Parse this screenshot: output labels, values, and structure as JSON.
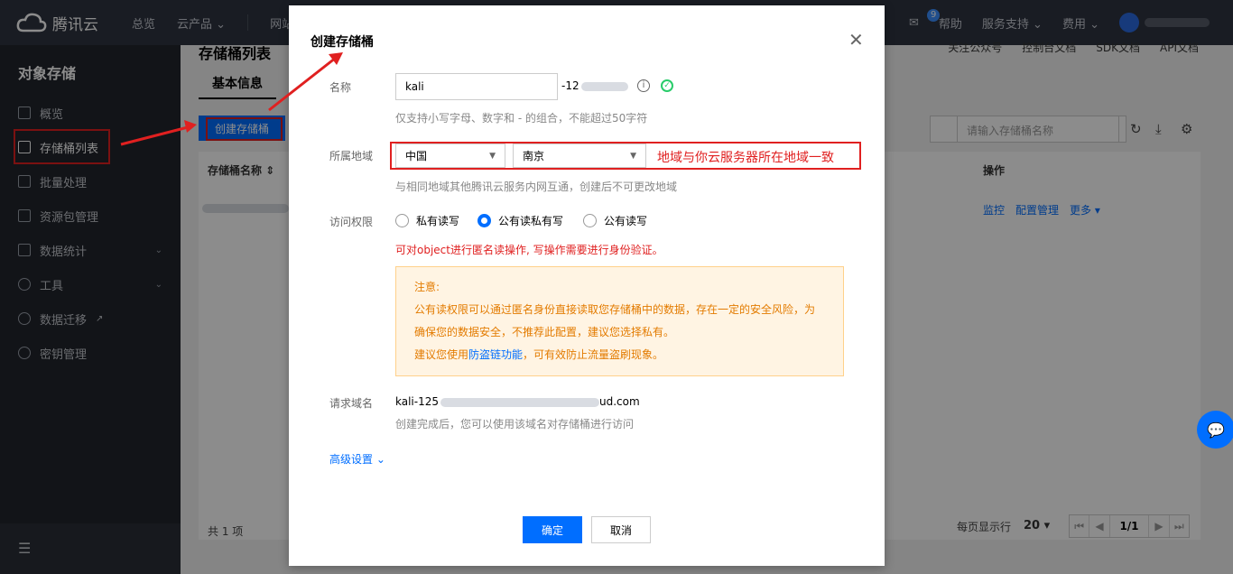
{
  "brand": {
    "name": "腾讯云"
  },
  "topnav": {
    "items": [
      "总览",
      "云产品",
      "网站备"
    ],
    "right": {
      "mail_badge": "9",
      "help": "帮助",
      "support": "服务支持",
      "fees": "费用"
    }
  },
  "sidebar": {
    "title": "对象存储",
    "items": [
      {
        "label": "概览"
      },
      {
        "label": "存储桶列表"
      },
      {
        "label": "批量处理"
      },
      {
        "label": "资源包管理"
      },
      {
        "label": "数据统计"
      },
      {
        "label": "工具"
      },
      {
        "label": "数据迁移"
      },
      {
        "label": "密钥管理"
      }
    ]
  },
  "main": {
    "title": "存储桶列表",
    "tab": "基本信息",
    "links": [
      "关注公众号",
      "控制台文档",
      "SDK文档",
      "API文档"
    ],
    "create_button": "创建存储桶",
    "search_placeholder": "请输入存储桶名称",
    "columns": {
      "name": "存储桶名称",
      "ops": "操作"
    },
    "row_actions": [
      "监控",
      "配置管理",
      "更多"
    ],
    "total": "共 1 项",
    "page_size_label": "每页显示行",
    "page_size": "20",
    "page": "1/1"
  },
  "dialog": {
    "title": "创建存储桶",
    "name_label": "名称",
    "name_value": "kali",
    "name_suffix": "-12",
    "name_hint": "仅支持小写字母、数字和 - 的组合，不能超过50字符",
    "region_label": "所属地域",
    "region_country": "中国",
    "region_city": "南京",
    "region_annotation": "地域与你云服务器所在地域一致",
    "region_hint": "与相同地域其他腾讯云服务内网互通，创建后不可更改地域",
    "access_label": "访问权限",
    "access_options": [
      "私有读写",
      "公有读私有写",
      "公有读写"
    ],
    "access_warning": "可对object进行匿名读操作, 写操作需要进行身份验证。",
    "notice_title": "注意:",
    "notice_line1": "公有读权限可以通过匿名身份直接读取您存储桶中的数据，存在一定的安全风险，为",
    "notice_line2": "确保您的数据安全，不推荐此配置，建议您选择私有。",
    "notice_line3_prefix": "建议您使用",
    "notice_link": "防盗链功能",
    "notice_line3_suffix": "，可有效防止流量盗刷现象。",
    "domain_label": "请求域名",
    "domain_prefix": "kali-125",
    "domain_suffix": "ud.com",
    "domain_hint": "创建完成后，您可以使用该域名对存储桶进行访问",
    "advanced": "高级设置",
    "ok": "确定",
    "cancel": "取消"
  },
  "colors": {
    "accent": "#006eff",
    "annotation": "#e02020",
    "warning_text": "#e37b00"
  }
}
